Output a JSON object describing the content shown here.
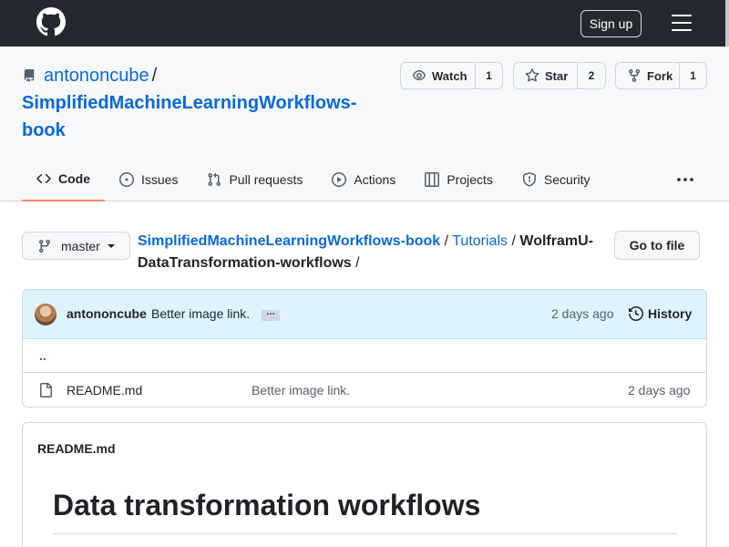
{
  "header": {
    "logo_icon": "github-mark-icon",
    "signup_label": "Sign up",
    "menu_icon": "hamburger-menu-icon"
  },
  "repo": {
    "icon": "repo-icon",
    "owner": "antononcube",
    "separator": "/",
    "name": "SimplifiedMachineLearningWorkflows-book",
    "watch": {
      "label": "Watch",
      "count": "1",
      "icon": "eye-icon"
    },
    "star": {
      "label": "Star",
      "count": "2",
      "icon": "star-icon"
    },
    "fork": {
      "label": "Fork",
      "count": "1",
      "icon": "fork-icon"
    }
  },
  "tabs": [
    {
      "label": "Code",
      "icon": "code-icon",
      "active": true
    },
    {
      "label": "Issues",
      "icon": "issue-icon"
    },
    {
      "label": "Pull requests",
      "icon": "pull-request-icon"
    },
    {
      "label": "Actions",
      "icon": "play-icon"
    },
    {
      "label": "Projects",
      "icon": "table-icon"
    },
    {
      "label": "Security",
      "icon": "shield-icon"
    }
  ],
  "more_icon": "kebab-horizontal-icon",
  "filenav": {
    "branch": "master",
    "branch_icon": "git-branch-icon",
    "breadcrumb_root": "SimplifiedMachineLearningWorkflows-book",
    "breadcrumb_sep": "/",
    "breadcrumb_folder": "Tutorials",
    "breadcrumb_current": "WolframU-DataTransformation-workflows",
    "go_to_file": "Go to file"
  },
  "commit": {
    "author": "antononcube",
    "message": "Better image link.",
    "ellipsis": "…",
    "age": "2 days ago",
    "history_label": "History",
    "history_icon": "history-icon"
  },
  "files": [
    {
      "name": "README.md",
      "message": "Better image link.",
      "age": "2 days ago",
      "icon": "file-icon"
    }
  ],
  "parent_dir": "..",
  "readme": {
    "label": "README.md",
    "heading": "Data transformation workflows"
  },
  "colors": {
    "header_bg": "#24292f",
    "link": "#0969da",
    "active_tab_underline": "#fd8c73",
    "commit_bar_bg": "#ddf4ff"
  }
}
